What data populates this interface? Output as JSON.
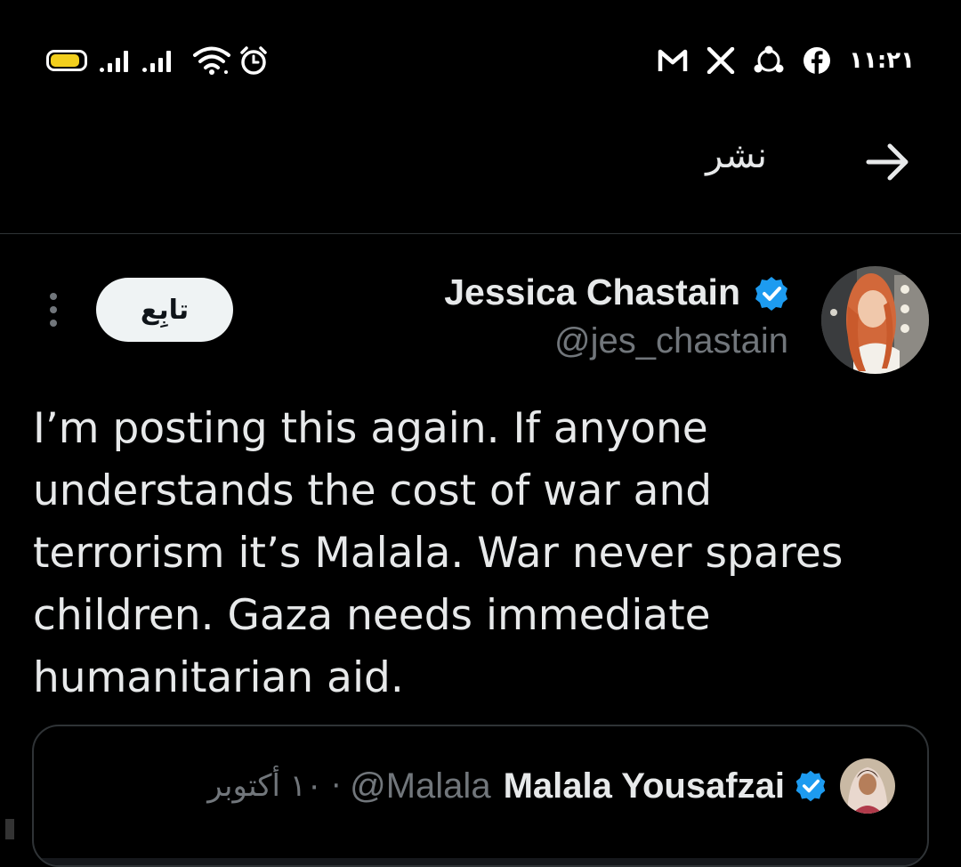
{
  "colors": {
    "background": "#000000",
    "text_primary": "#e7e9ea",
    "text_secondary": "#71767b",
    "verified_blue": "#1d9bf0",
    "battery_fill": "#f2cf1d",
    "border": "#2f3336"
  },
  "status_bar": {
    "time": "١١:٢١",
    "battery_level": 0.9,
    "left_icons": [
      "battery-icon",
      "signal-icon",
      "signal-icon",
      "wifi-icon",
      "alarm-icon"
    ],
    "right_icons": [
      "gmail-icon",
      "x-icon",
      "share-icon",
      "facebook-icon"
    ]
  },
  "header": {
    "title": "نشر",
    "back_icon": "arrow-right-icon"
  },
  "tweet": {
    "author_name": "Jessica Chastain",
    "author_handle": "@jes_chastain",
    "verified": true,
    "follow_label": "تابِع",
    "more_icon": "more-vertical-icon",
    "text": "I’m posting this again. If anyone\nunderstands the cost of war and\nterrorism it’s Malala. War never spares\nchildren. Gaza needs immediate\nhumanitarian aid."
  },
  "quoted_tweet": {
    "author_name": "Malala Yousafzai",
    "author_handle": "@Malala",
    "separator": "·",
    "date": "١٠ أكتوبر",
    "verified": true
  }
}
